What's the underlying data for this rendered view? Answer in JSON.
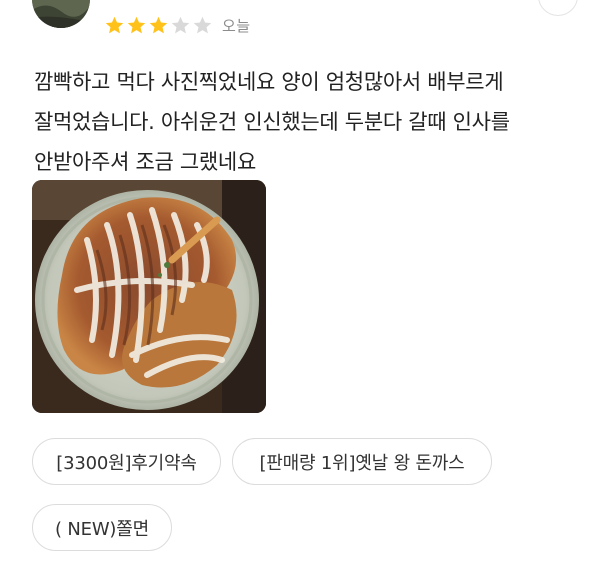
{
  "review": {
    "rating": 3,
    "max_rating": 5,
    "date": "오늘",
    "text": "깜빡하고 먹다 사진찍었네요 양이 엄청많아서 배부르게 잘먹었습니다. 아쉬운건 인신했는데 두분다 갈때 인사를 안받아주셔 조금 그랬네요"
  },
  "tags": [
    "[3300원]후기약속",
    "[판매량 1위]옛날 왕 돈까스",
    "( NEW)쫄면"
  ],
  "colors": {
    "star_filled": "#FFC21A",
    "star_empty": "#D9D9D9"
  }
}
